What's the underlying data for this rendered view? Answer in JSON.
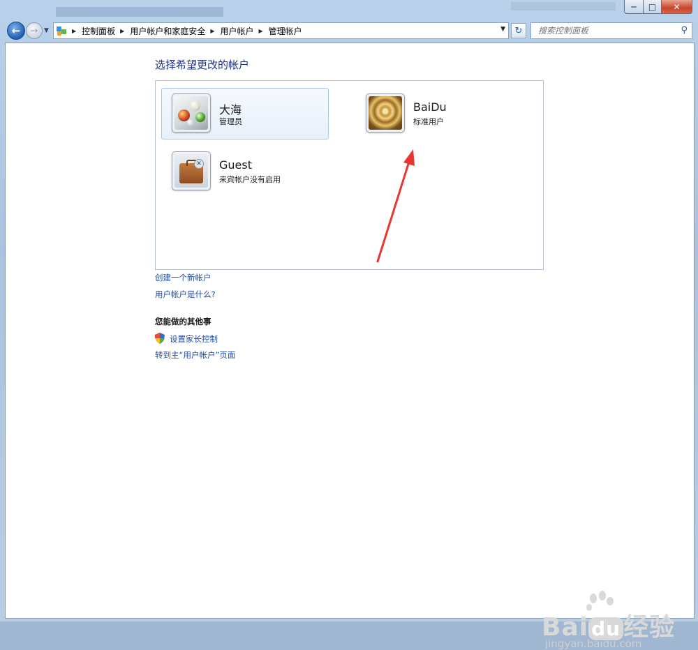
{
  "window": {
    "min_label": "─",
    "max_label": "□",
    "close_label": "✕"
  },
  "nav": {
    "back_glyph": "←",
    "forward_glyph": "→",
    "breadcrumbs": [
      "控制面板",
      "用户帐户和家庭安全",
      "用户帐户",
      "管理帐户"
    ],
    "search_placeholder": "搜索控制面板"
  },
  "main": {
    "heading": "选择希望更改的帐户",
    "accounts": [
      {
        "name": "大海",
        "role": "管理员",
        "avatar": "marbles-icon",
        "selected": true
      },
      {
        "name": "BaiDu",
        "role": "标准用户",
        "avatar": "golden-spiral-icon",
        "selected": false
      },
      {
        "name": "Guest",
        "role": "来宾帐户没有启用",
        "avatar": "briefcase-icon",
        "selected": false
      }
    ],
    "links": {
      "create_account": "创建一个新帐户",
      "what_is_account": "用户帐户是什么?"
    },
    "other_heading": "您能做的其他事",
    "other_links": {
      "parental_control": "设置家长控制",
      "goto_main": "转到主“用户帐户”页面"
    }
  },
  "watermark": {
    "brand_a": "Bai",
    "brand_b": "du",
    "brand_c": "经验",
    "url": "jingyan.baidu.com"
  },
  "colors": {
    "link": "#1f4ba6",
    "heading": "#1e3287",
    "arrow": "#e8372f"
  }
}
